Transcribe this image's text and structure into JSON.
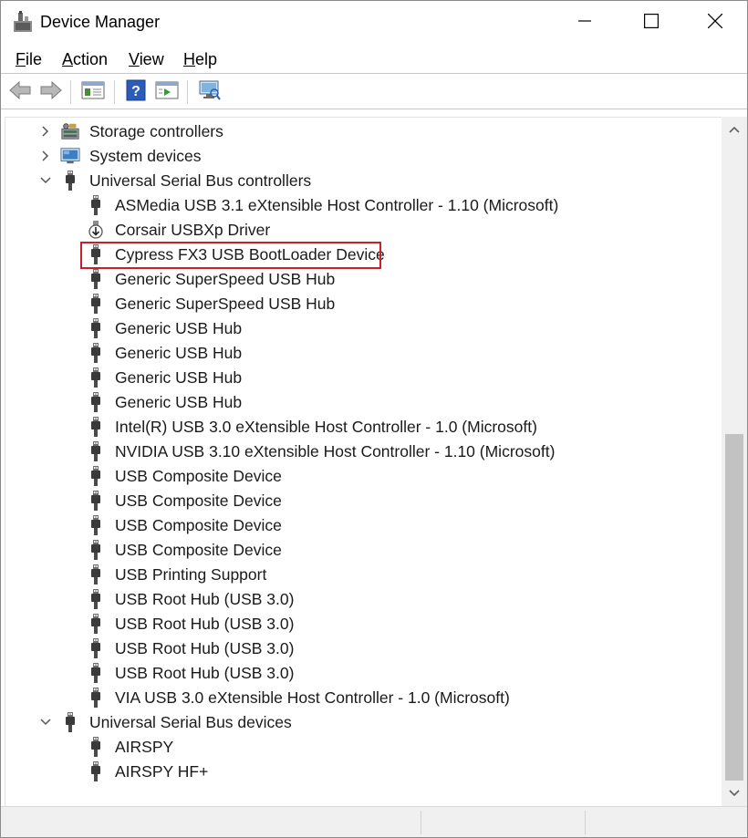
{
  "window": {
    "title": "Device Manager"
  },
  "menu": {
    "items": [
      {
        "label": "File",
        "accel": "F",
        "rest": "ile"
      },
      {
        "label": "Action",
        "accel": "A",
        "rest": "ction"
      },
      {
        "label": "View",
        "accel": "V",
        "rest": "iew"
      },
      {
        "label": "Help",
        "accel": "H",
        "rest": "elp"
      }
    ]
  },
  "toolbar": {
    "icons": [
      "back-arrow-icon",
      "forward-arrow-icon",
      "properties-pane-icon",
      "help-question-icon",
      "run-pane-icon",
      "scan-hardware-monitor-icon"
    ]
  },
  "tree": {
    "nodes": [
      {
        "label": "Storage controllers",
        "level": 0,
        "expander": "collapsed",
        "icon": "storage-controller-icon"
      },
      {
        "label": "System devices",
        "level": 0,
        "expander": "collapsed",
        "icon": "system-devices-icon"
      },
      {
        "label": "Universal Serial Bus controllers",
        "level": 0,
        "expander": "expanded",
        "icon": "usb-plug-icon"
      },
      {
        "label": "ASMedia USB 3.1 eXtensible Host Controller - 1.10 (Microsoft)",
        "level": 1,
        "icon": "usb-plug-icon"
      },
      {
        "label": "Corsair USBXp Driver",
        "level": 1,
        "icon": "usb-download-icon"
      },
      {
        "label": "Cypress FX3 USB BootLoader Device",
        "level": 1,
        "icon": "usb-plug-icon",
        "highlighted": true
      },
      {
        "label": "Generic SuperSpeed USB Hub",
        "level": 1,
        "icon": "usb-plug-icon"
      },
      {
        "label": "Generic SuperSpeed USB Hub",
        "level": 1,
        "icon": "usb-plug-icon"
      },
      {
        "label": "Generic USB Hub",
        "level": 1,
        "icon": "usb-plug-icon"
      },
      {
        "label": "Generic USB Hub",
        "level": 1,
        "icon": "usb-plug-icon"
      },
      {
        "label": "Generic USB Hub",
        "level": 1,
        "icon": "usb-plug-icon"
      },
      {
        "label": "Generic USB Hub",
        "level": 1,
        "icon": "usb-plug-icon"
      },
      {
        "label": "Intel(R) USB 3.0 eXtensible Host Controller - 1.0 (Microsoft)",
        "level": 1,
        "icon": "usb-plug-icon"
      },
      {
        "label": "NVIDIA USB 3.10 eXtensible Host Controller - 1.10 (Microsoft)",
        "level": 1,
        "icon": "usb-plug-icon"
      },
      {
        "label": "USB Composite Device",
        "level": 1,
        "icon": "usb-plug-icon"
      },
      {
        "label": "USB Composite Device",
        "level": 1,
        "icon": "usb-plug-icon"
      },
      {
        "label": "USB Composite Device",
        "level": 1,
        "icon": "usb-plug-icon"
      },
      {
        "label": "USB Composite Device",
        "level": 1,
        "icon": "usb-plug-icon"
      },
      {
        "label": "USB Printing Support",
        "level": 1,
        "icon": "usb-plug-icon"
      },
      {
        "label": "USB Root Hub (USB 3.0)",
        "level": 1,
        "icon": "usb-plug-icon"
      },
      {
        "label": "USB Root Hub (USB 3.0)",
        "level": 1,
        "icon": "usb-plug-icon"
      },
      {
        "label": "USB Root Hub (USB 3.0)",
        "level": 1,
        "icon": "usb-plug-icon"
      },
      {
        "label": "USB Root Hub (USB 3.0)",
        "level": 1,
        "icon": "usb-plug-icon"
      },
      {
        "label": "VIA USB 3.0 eXtensible Host Controller - 1.0 (Microsoft)",
        "level": 1,
        "icon": "usb-plug-icon"
      },
      {
        "label": "Universal Serial Bus devices",
        "level": 0,
        "expander": "expanded",
        "icon": "usb-plug-icon"
      },
      {
        "label": "AIRSPY",
        "level": 1,
        "icon": "usb-plug-icon"
      },
      {
        "label": "AIRSPY HF+",
        "level": 1,
        "icon": "usb-plug-icon"
      }
    ]
  },
  "colors": {
    "highlight_border": "#c8202a",
    "text": "#1a1a1a",
    "scrollbar_thumb": "#c2c2c2"
  }
}
